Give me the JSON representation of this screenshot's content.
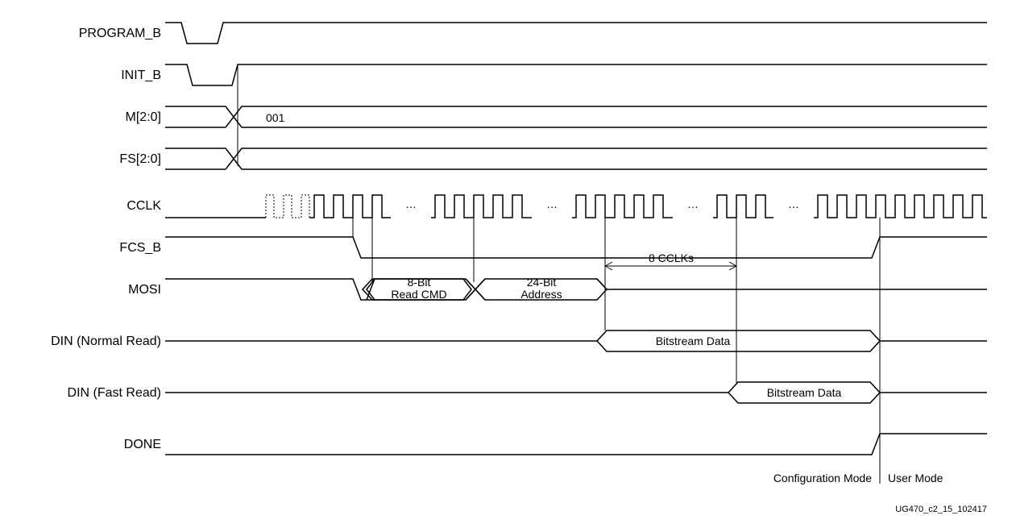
{
  "labels": {
    "program_b": "PROGRAM_B",
    "init_b": "INIT_B",
    "m": "M[2:0]",
    "fs": "FS[2:0]",
    "cclk": "CCLK",
    "fcs_b": "FCS_B",
    "mosi": "MOSI",
    "din_normal": "DIN (Normal Read)",
    "din_fast": "DIN (Fast Read)",
    "done": "DONE"
  },
  "values": {
    "m_value": "001",
    "read_cmd": "8-Bit\nRead CMD",
    "read_cmd_l1": "8-Bit",
    "read_cmd_l2": "Read CMD",
    "address": "24-Bit\nAddress",
    "address_l1": "24-Bit",
    "address_l2": "Address",
    "cclks": "8 CCLKs",
    "bitstream": "Bitstream Data",
    "config_mode": "Configuration Mode",
    "user_mode": "User Mode",
    "figure_id": "UG470_c2_15_102417"
  },
  "meta": {
    "description": "Master-SPI configuration timing diagram showing PROGRAM_B, INIT_B, M[2:0]=001, FS[2:0], CCLK bursts, FCS_B assertion, MOSI 8-bit read command then 24-bit address, DIN bitstream (normal read immediately, fast read after 8 CCLK dummy cycles), DONE rising to enter User Mode."
  }
}
